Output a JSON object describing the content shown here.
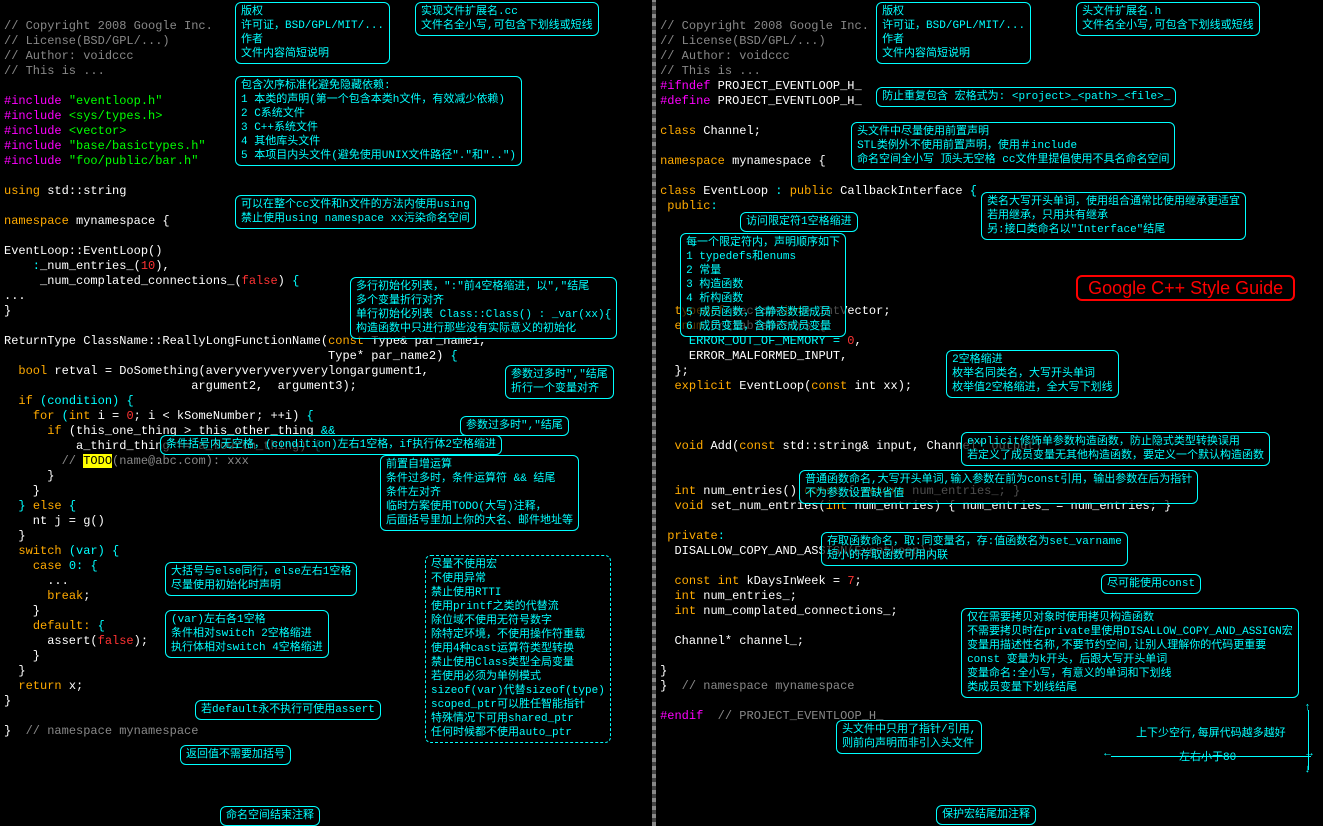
{
  "title": "Google C++ Style Guide",
  "left": {
    "h1": "// Copyright 2008 Google Inc.",
    "h2": "// License(BSD/GPL/...)",
    "h3": "// Author: voidccc",
    "h4": "// This is ...",
    "inc1k": "#include",
    "inc1v": "\"eventloop.h\"",
    "inc2k": "#include",
    "inc2v": "<sys/types.h>",
    "inc3k": "#include",
    "inc3v": "<vector>",
    "inc4k": "#include",
    "inc4v": "\"base/basictypes.h\"",
    "inc5k": "#include",
    "inc5v": "\"foo/public/bar.h\"",
    "using": "using",
    "using_v": "std::string",
    "ns": "namespace",
    "ns_v": "mynamespace {",
    "ctor": "EventLoop::EventLoop()",
    "init1a": "    :",
    "init1b": "_num_entries_(",
    "init1c": "10",
    "init1d": "),",
    "init2a": "     _num_complated_connections_(",
    "init2b": "false",
    "init2c": ")",
    "init2d": "{",
    "dots": "...",
    "cbr": "}",
    "fn_prefix": "ReturnType ClassName::ReallyLongFunctionName(",
    "fn_const": "const",
    "fn_p1": " Type& par_name1,",
    "fn_p2": "                                             Type* par_name2)",
    "fn_ob": "{",
    "bool": "bool",
    "retvar": " retval = DoSomething(averyveryveryverylongargument1,",
    "args23": "                          argument2,  argument3);",
    "if": "if",
    "cond": "(condition)",
    "ob": "{",
    "for": "for",
    "forp": "(",
    "intk": "int",
    "fori": " i = ",
    "zero": "0",
    "forrest": "; i < kSomeNumber; ++i)",
    "ob2": "{",
    "if2": "if",
    "if2c": " (this_one_thing > this_other_thing ",
    "amp": "&&",
    "if2c2": "          a_third_thing == a_fourth_thing)",
    "ob3": "{",
    "todo_pre": "        // ",
    "todo": "TODO",
    "todo_post": "(name@abc.com): xxx",
    "cb": "      }",
    "cb2": "    }",
    "else_line": "  }",
    "else": "else",
    "ob4": "{",
    "ntj": "    nt j = g()",
    "cb3": "  }",
    "switch": "switch",
    "swv": "(var)",
    "ob5": "{",
    "case": "case",
    "casev": "0:",
    "ob6": "{",
    "cdots": "      ...",
    "break": "break",
    "cb4": "    }",
    "default": "default:",
    "ob7": "{",
    "assert": "      assert(",
    "false2": "false",
    "assert2": ");",
    "cb5": "    }",
    "cb6": "  }",
    "return": "return",
    "retval": " x;",
    "cb7": "}",
    "nsend": "}  ",
    "nsend_c": "// namespace mynamespace",
    "note_header": "版权\n许可证，BSD/GPL/MIT/...\n作者\n文件内容简短说明",
    "note_ext": "实现文件扩展名.cc\n文件名全小写,可包含下划线或短线",
    "note_includes": "包含次序标准化避免隐藏依赖:\n1 本类的声明(第一个包含本类h文件，有效减少依赖)\n2 C系统文件\n3 C++系统文件\n4 其他库头文件\n5 本项目内头文件(避免使用UNIX文件路径\".\"和\"..\")",
    "note_using": "可以在整个cc文件和h文件的方法内使用using\n禁止使用using namespace xx污染命名空间",
    "note_ctor": "多行初始化列表，\":\"前4空格缩进，以\",\"结尾\n多个变量折行对齐\n单行初始化列表 Class::Class() : _var(xx){\n构造函数中只进行那些没有实际意义的初始化",
    "note_fn1": "参数过多时\",\"结尾\n折行一个变量对齐",
    "note_args": "参数过多时\",\"结尾",
    "note_if": "条件括号内无空格，(condition)左右1空格，if执行体2空格缩进",
    "note_for": "前置自增运算\n条件过多时，条件运算符 && 结尾\n条件左对齐\n临时方案使用TODO(大写)注释，\n后面括号里加上你的大名、邮件地址等",
    "note_else": "大括号与else同行，else左右1空格\n尽量使用初始化时声明",
    "note_switch": "(var)左右各1空格\n条件相对switch 2空格缩进\n执行体相对switch 4空格缩进",
    "note_assert": "若default永不执行可使用assert",
    "note_return": "返回值不需要加括号",
    "note_nsend": "命名空间结束注释",
    "note_tips": "尽量不使用宏\n不使用异常\n禁止使用RTTI\n使用printf之类的代替流\n除位域不使用无符号数字\n除特定环境，不使用操作符重载\n使用4种cast运算符类型转换\n禁止使用Class类型全局变量\n若使用必须为单例模式\nsizeof(var)代替sizeof(type)\nscoped_ptr可以胜任智能指针\n特殊情况下可用shared_ptr\n任何时候都不使用auto_ptr"
  },
  "right": {
    "h1": "// Copyright 2008 Google Inc.",
    "h2": "// License(BSD/GPL/...)",
    "h3": "// Author: voidccc",
    "h4": "// This is ...",
    "ifndef": "#ifndef",
    "guard": " PROJECT_EVENTLOOP_H_",
    "define": "#define",
    "guard2": " PROJECT_EVENTLOOP_H_",
    "class": "class",
    "channel": " Channel;",
    "ns": "namespace",
    "ns_v": " mynamespace {",
    "class2": "class",
    "cname": " EventLoop ",
    ":": ":",
    "public": " public",
    "cbif": " CallbackInterface ",
    "ob": "{",
    "pub": "public",
    ":2": ":",
    "typedef": "typedef",
    "tvec": " vector<",
    "int": "int",
    "tvec2": "> IntVector;",
    "enum": "enum",
    "enumname": " UrlTableErrors {",
    "e1": "    ERROR_OUT_OF_MEMORY = ",
    "zero": "0",
    "e1c": ",",
    "e2": "    ERROR_MALFORMED_INPUT,",
    "ecb": "  };",
    "explicit": "explicit",
    "expv": " EventLoop(",
    "const": "const",
    "expv2": " int xx);",
    "void": "void",
    "add": " Add(",
    "const2": "const",
    "addv": " std::string& input, Channel* output)",
    "int2": "int",
    "ne": " num_entries() ",
    "const3": "const",
    "neb": " { ",
    "return": "return",
    "nev": " num_entries_; }",
    "void2": "void",
    "sne": " set_num_entries(",
    "int3": "int",
    "snev": " num_entries) { num_entries_ = num_entries; }",
    "private": "private",
    ":3": ":",
    "disallow": "  DISALLOW_COPY_AND_ASSIGN(EventLoop);",
    "constint": "const int",
    "kday": " kDaysInWeek = ",
    "seven": "7",
    "sc": ";",
    "int4": "int",
    "nm": " num_entries_;",
    "int5": "int",
    "ncc": " num_complated_connections_;",
    "chan": "  Channel* channel_;",
    "cb": "}",
    "nsend": "}  ",
    "nsend_c": "// namespace mynamespace",
    "endif": "#endif",
    "endc": "  // PROJECT_EVENTLOOP_H_",
    "note_header": "版权\n许可证，BSD/GPL/MIT/...\n作者\n文件内容简短说明",
    "note_ext": "头文件扩展名.h\n文件名全小写,可包含下划线或短线",
    "note_guard": "防止重复包含 宏格式为: <project>_<path>_<file>_",
    "note_forward": "头文件中尽量使用前置声明\nSTL类例外不使用前置声明，使用＃include\n命名空间全小写 顶头无空格 cc文件里提倡使用不具名命名空间",
    "note_class": "类名大写开头单词，使用组合通常比使用继承更适宜\n若用继承，只用共有继承\n另:接口类命名以\"Interface\"结尾",
    "note_pub": "访问限定符1空格缩进",
    "note_order": "每一个限定符内，声明顺序如下\n1 typedefs和enums\n2 常量\n3 构造函数\n4 析构函数\n5 成员函数，含静态数据成员\n6 成员变量，含静态成员变量",
    "note_typedef": "2空格缩进\n枚举名同类名，大写开头单词\n枚举值2空格缩进，全大写下划线",
    "note_explicit": "explicit修饰单参数构造函数，防止隐式类型转换误用\n若定义了成员变量无其他构造函数，要定义一个默认构造函数",
    "note_add": "普通函数命名,大写开头单词,输入参数在前为const引用，输出参数在后为指针\n不为参数设置缺省值",
    "note_accessor": "存取函数命名，取:同变量名，存:值函数名为set_varname\n短小的存取函数可用内联",
    "note_const": "尽可能使用const",
    "note_private": "仅在需要拷贝对象时使用拷贝构造函数\n不需要拷贝时在private里使用DISALLOW_COPY_AND_ASSIGN宏\n变量用描述性名称,不要节约空间,让别人理解你的代码更重要\nconst 变量为k开头，后跟大写开头单词\n变量命名:全小写，有意义的单词和下划线\n类成员变量下划线结尾",
    "note_chan": "头文件中只用了指针/引用,\n则前向声明而非引入头文件",
    "note_endif": "保护宏结尾加注释",
    "note_vert": "上下少空行,每屏代码越多越好",
    "note_horiz": "左右小于80"
  }
}
